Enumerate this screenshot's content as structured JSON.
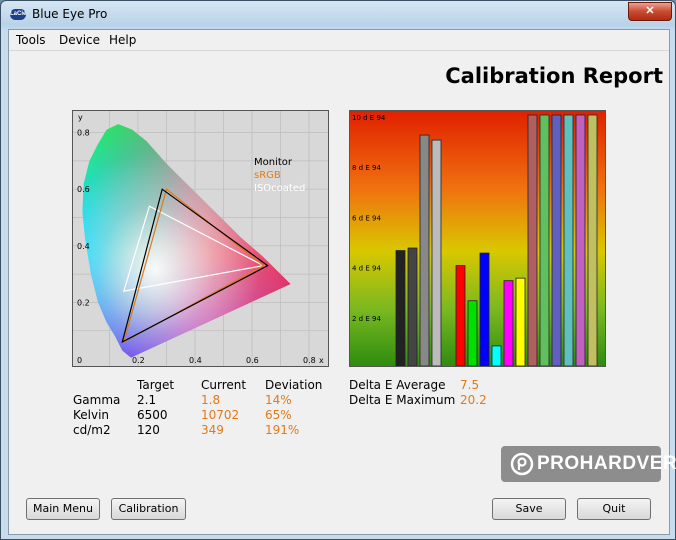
{
  "window": {
    "title": "Blue Eye Pro",
    "app_icon_text": "LaCie",
    "close_glyph": "✕"
  },
  "menu": [
    "Tools",
    "Device",
    "Help"
  ],
  "report": {
    "title": "Calibration Report"
  },
  "cie_chart": {
    "axis_y_label": "y",
    "axis_x_label": "x",
    "y_ticks": [
      "0.8",
      "0.6",
      "0.4",
      "0.2",
      "0"
    ],
    "x_ticks": [
      "0.2",
      "0.4",
      "0.6",
      "0.8"
    ],
    "legend": [
      {
        "label": "Monitor",
        "color": "#000000"
      },
      {
        "label": "sRGB",
        "color": "#e07a1a"
      },
      {
        "label": "ISOcoated",
        "color": "#ffffff"
      }
    ],
    "gamuts": {
      "monitor": [
        [
          0.655,
          0.33
        ],
        [
          0.285,
          0.6
        ],
        [
          0.145,
          0.06
        ]
      ],
      "srgb": [
        [
          0.64,
          0.33
        ],
        [
          0.3,
          0.6
        ],
        [
          0.15,
          0.06
        ]
      ],
      "isocoated": [
        [
          0.64,
          0.33
        ],
        [
          0.24,
          0.54
        ],
        [
          0.15,
          0.24
        ]
      ]
    }
  },
  "chart_data": {
    "type": "bar",
    "ylabel": "d E 94",
    "tick_labels": [
      "10 d E 94",
      "8 d E 94",
      "6 d E 94",
      "4 d E 94",
      "2 d E 94"
    ],
    "ylim": [
      0,
      10
    ],
    "bars": [
      {
        "value": 4.6,
        "color": "#222222"
      },
      {
        "value": 4.7,
        "color": "#444444"
      },
      {
        "value": 9.2,
        "color": "#888888"
      },
      {
        "value": 9.0,
        "color": "#bbbbbb"
      },
      {
        "value": 0,
        "color": "#000000"
      },
      {
        "value": 4.0,
        "color": "#ff0000"
      },
      {
        "value": 2.6,
        "color": "#00e000"
      },
      {
        "value": 4.5,
        "color": "#0000ff"
      },
      {
        "value": 0.8,
        "color": "#00ffff"
      },
      {
        "value": 3.4,
        "color": "#ff00ff"
      },
      {
        "value": 3.5,
        "color": "#ffff00"
      },
      {
        "value": 10,
        "color": "#b06060"
      },
      {
        "value": 10,
        "color": "#60c060"
      },
      {
        "value": 10,
        "color": "#6060c0"
      },
      {
        "value": 10,
        "color": "#60c0c0"
      },
      {
        "value": 10,
        "color": "#c060c0"
      },
      {
        "value": 10,
        "color": "#c0c060"
      }
    ]
  },
  "stats": {
    "headers": {
      "target": "Target",
      "current": "Current",
      "deviation": "Deviation"
    },
    "rows": [
      {
        "label": "Gamma",
        "target": "2.1",
        "current": "1.8",
        "deviation": "14%"
      },
      {
        "label": "Kelvin",
        "target": "6500",
        "current": "10702",
        "deviation": "65%"
      },
      {
        "label": "cd/m2",
        "target": "120",
        "current": "349",
        "deviation": "191%"
      }
    ],
    "delta_avg_label": "Delta E Average",
    "delta_avg_value": "7.5",
    "delta_max_label": "Delta E Maximum",
    "delta_max_value": "20.2"
  },
  "watermark": "PROHARDVER!",
  "buttons": {
    "main_menu": "Main Menu",
    "calibration": "Calibration",
    "save": "Save",
    "quit": "Quit"
  }
}
